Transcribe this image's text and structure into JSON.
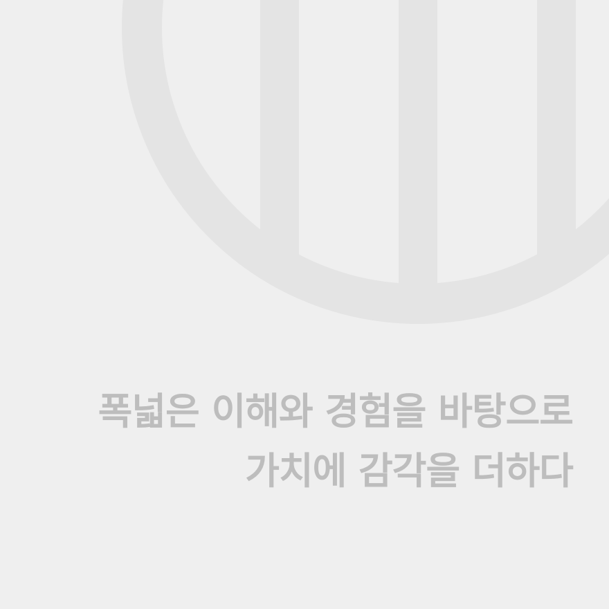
{
  "emblem": {
    "icon": "circle-with-vertical-bars-logo",
    "color": "#e4e4e4"
  },
  "tagline": {
    "line1": "폭넓은 이해와 경험을 바탕으로",
    "line2": "가치에 감각을 더하다",
    "color": "#bdbdbd"
  },
  "background": "#efefef"
}
